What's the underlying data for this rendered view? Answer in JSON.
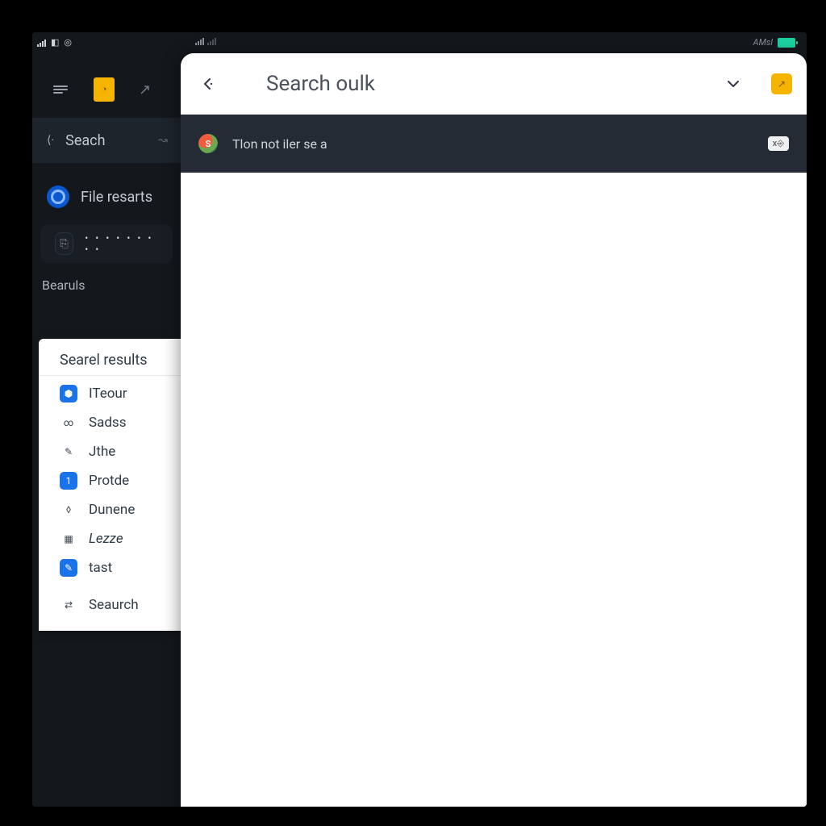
{
  "status": {
    "right_label": "AMsl"
  },
  "sidebar": {
    "search_label": "Seach",
    "file_results_label": "File resarts",
    "password_dots": "• • • • • • • • •",
    "section_header": "Bearuls"
  },
  "results": {
    "title": "Searel results",
    "items": [
      {
        "label": "ITeour",
        "glyph": "⬢",
        "style": "blue"
      },
      {
        "label": "Sadss",
        "glyph": "∞",
        "style": "gray"
      },
      {
        "label": "Jthe",
        "glyph": "✎",
        "style": "gray"
      },
      {
        "label": "Protde",
        "glyph": "1",
        "style": "blue"
      },
      {
        "label": "Dunene",
        "glyph": "◊",
        "style": "outline"
      },
      {
        "label": "Lezze",
        "glyph": "▦",
        "style": "gray",
        "italic": true
      },
      {
        "label": "tast",
        "glyph": "✎",
        "style": "blue"
      }
    ],
    "footer": {
      "label": "Seaurch",
      "glyph": "⇄"
    }
  },
  "main": {
    "title": "Search oulk",
    "banner": {
      "badge": "S",
      "text": "Tlon not iler se a",
      "chip": "x⎆"
    }
  }
}
